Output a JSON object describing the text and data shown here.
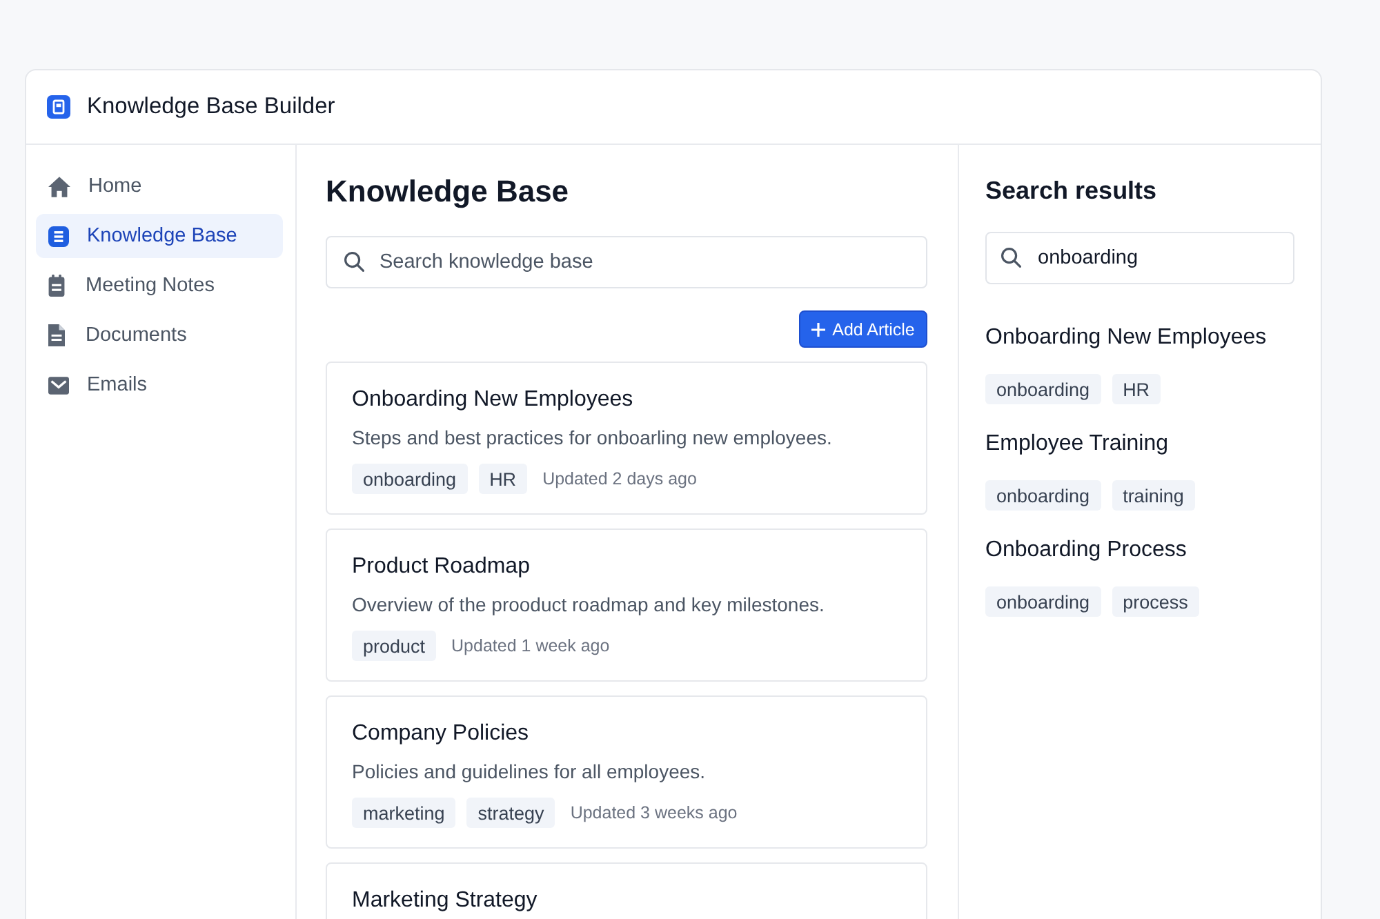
{
  "window": {
    "title": "Knowledge Base Builder"
  },
  "sidebar": {
    "items": [
      {
        "label": "Home",
        "selected": false
      },
      {
        "label": "Knowledge Base",
        "selected": true
      },
      {
        "label": "Meeting Notes",
        "selected": false
      },
      {
        "label": "Documents",
        "selected": false
      },
      {
        "label": "Emails",
        "selected": false
      }
    ]
  },
  "main": {
    "title": "Knowledge Base",
    "search": {
      "placeholder": "Search knowledge base"
    },
    "add_button": {
      "label": "Add Article"
    },
    "articles": [
      {
        "title": "Onboarding New Employees",
        "description": "Steps and best practices for onboarling new employees.",
        "tags": [
          "onboarding",
          "HR"
        ],
        "updated": "Updated 2 days ago"
      },
      {
        "title": "Product Roadmap",
        "description": "Overview of the prooduct roadmap and key milestones.",
        "tags": [
          "product"
        ],
        "updated": "Updated 1 week ago"
      },
      {
        "title": "Company Policies",
        "description": "Policies and guidelines for all employees.",
        "tags": [
          "marketing",
          "strategy"
        ],
        "updated": "Updated 3 weeks ago"
      },
      {
        "title": "Marketing Strategy"
      }
    ]
  },
  "search_results": {
    "title": "Search results",
    "search": {
      "value": "onboarding"
    },
    "results": [
      {
        "title": "Onboarding New Employees",
        "tags": [
          "onboarding",
          "HR"
        ]
      },
      {
        "title": "Employee Training",
        "tags": [
          "onboarding",
          "training"
        ]
      },
      {
        "title": "Onboarding Process",
        "tags": [
          "onboarding",
          "process"
        ]
      }
    ]
  }
}
